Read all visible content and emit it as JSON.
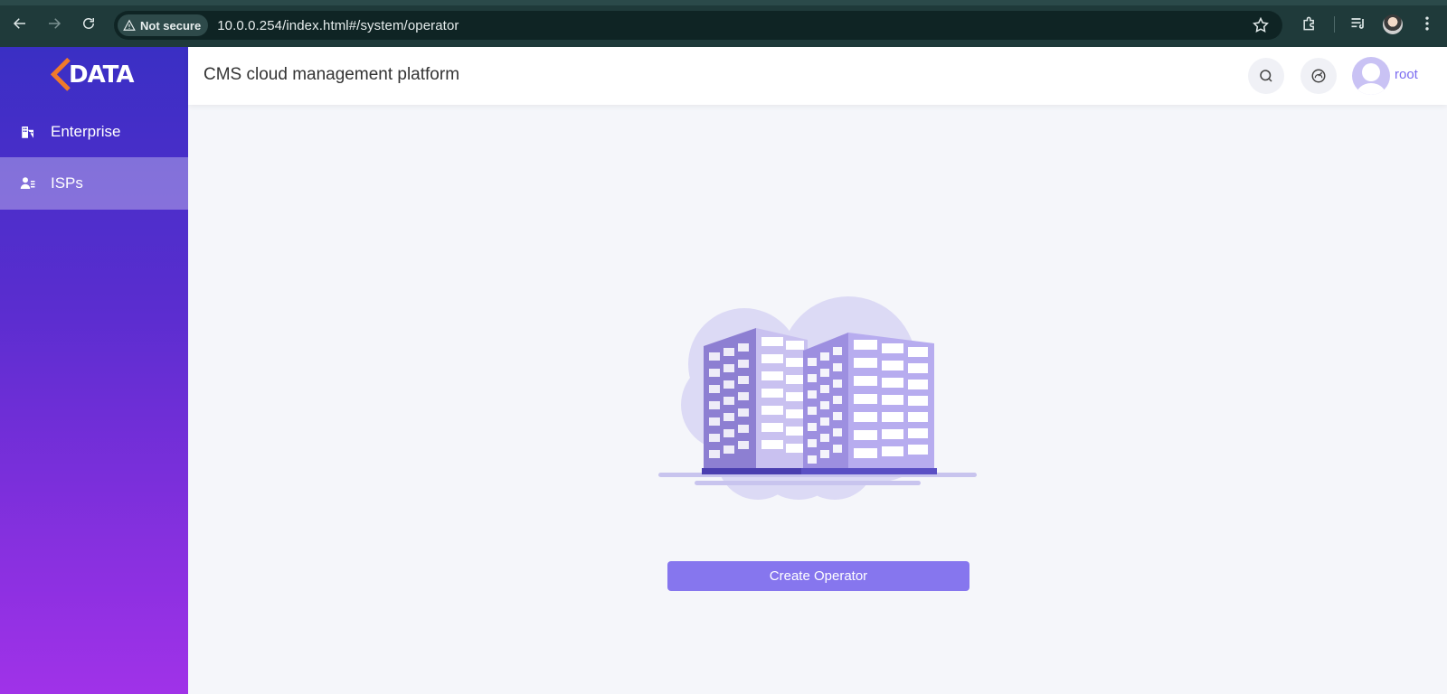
{
  "browser": {
    "security_label": "Not secure",
    "url": "10.0.0.254/index.html#/system/operator"
  },
  "sidebar": {
    "logo_text": "DATA",
    "items": [
      {
        "label": "Enterprise",
        "icon": "building-icon",
        "active": false
      },
      {
        "label": "ISPs",
        "icon": "user-list-icon",
        "active": true
      }
    ]
  },
  "header": {
    "title": "CMS cloud management platform",
    "user_name": "root"
  },
  "main": {
    "create_button_label": "Create Operator"
  },
  "colors": {
    "accent": "#8676ee",
    "sidebar_top": "#3a2fc4",
    "sidebar_bottom": "#a032e8",
    "logo_orange": "#f07a2a"
  }
}
